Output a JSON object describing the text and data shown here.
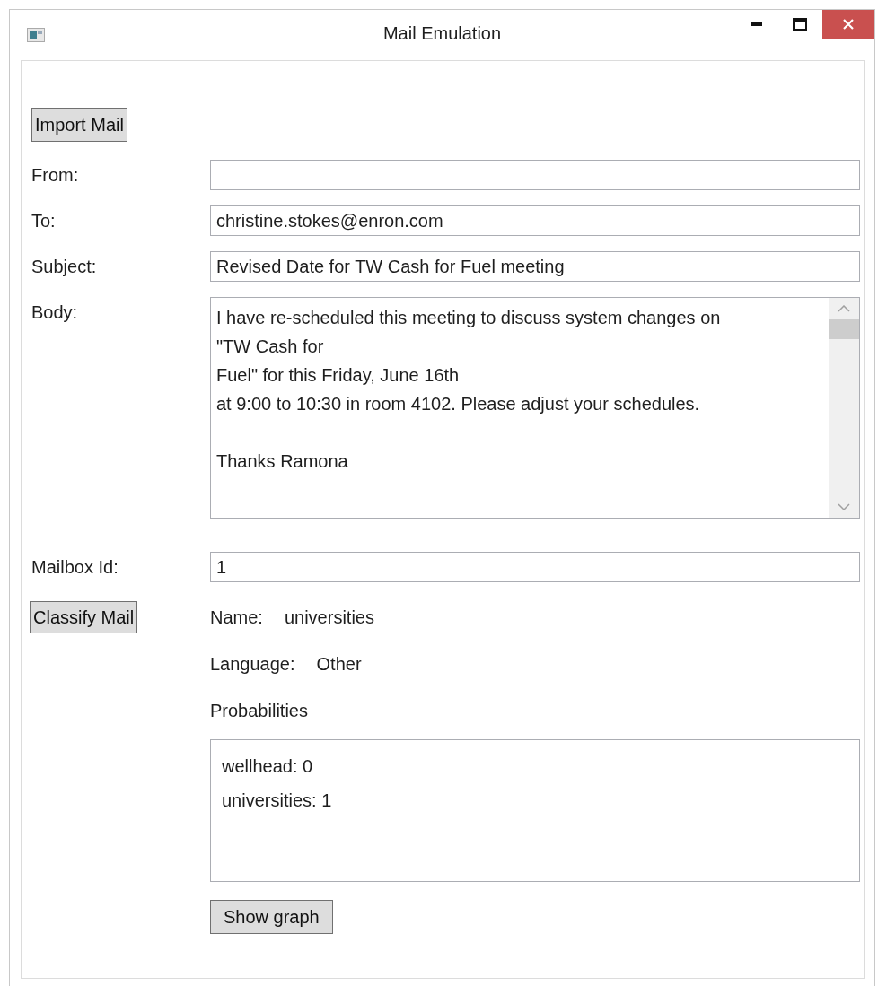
{
  "window": {
    "title": "Mail Emulation"
  },
  "import_button": "Import Mail",
  "fields": [
    {
      "label": "From:"
    },
    {
      "label": "To:",
      "value": "christine.stokes@enron.com"
    },
    {
      "label": "Subject:",
      "value": "Revised Date for TW Cash for Fuel meeting"
    }
  ],
  "body": {
    "label": "Body:",
    "value": "I have re-scheduled this meeting to discuss system changes on\n\"TW Cash for\nFuel\" for this Friday, June 16th\nat 9:00 to 10:30 in room 4102. Please adjust your schedules.\n\nThanks Ramona"
  },
  "mailbox": {
    "label": "Mailbox Id:",
    "value": "1"
  },
  "classify_button": "Classify Mail",
  "result": {
    "name_label": "Name:",
    "name": "universities",
    "language_label": "Language:",
    "language": "Other",
    "probabilities_label": "Probabilities",
    "probabilities": [
      "wellhead: 0",
      "universities: 1"
    ]
  },
  "show_graph_button": "Show graph"
}
